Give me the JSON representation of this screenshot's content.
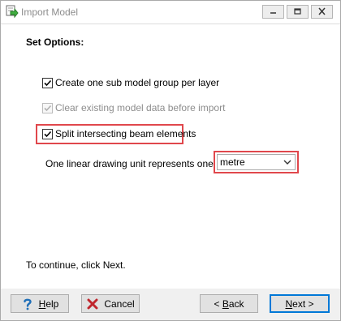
{
  "window": {
    "title": "Import Model",
    "controls": {
      "minimize": "minimize-icon",
      "restore": "restore-icon",
      "close": "close-icon"
    }
  },
  "section": {
    "heading": "Set Options:"
  },
  "options": [
    {
      "label": "Create one sub model group per layer",
      "checked": true,
      "enabled": true
    },
    {
      "label": "Clear existing model data before import",
      "checked": true,
      "enabled": false
    },
    {
      "label": "Split intersecting beam elements",
      "checked": true,
      "enabled": true,
      "highlighted": true
    }
  ],
  "units": {
    "label": "One linear drawing unit represents one...",
    "selected": "metre",
    "highlighted": true
  },
  "instruction": "To continue, click Next.",
  "buttons": {
    "help": {
      "accel": "H",
      "rest": "elp"
    },
    "cancel": {
      "label": "Cancel"
    },
    "back": {
      "prefix": "< ",
      "accel": "B",
      "rest": "ack"
    },
    "next": {
      "accel": "N",
      "rest": "ext >"
    }
  },
  "colors": {
    "highlight": "#e0474c",
    "focus": "#0078d7",
    "help_icon": "#1f6fb8",
    "cancel_icon": "#c0262d"
  }
}
